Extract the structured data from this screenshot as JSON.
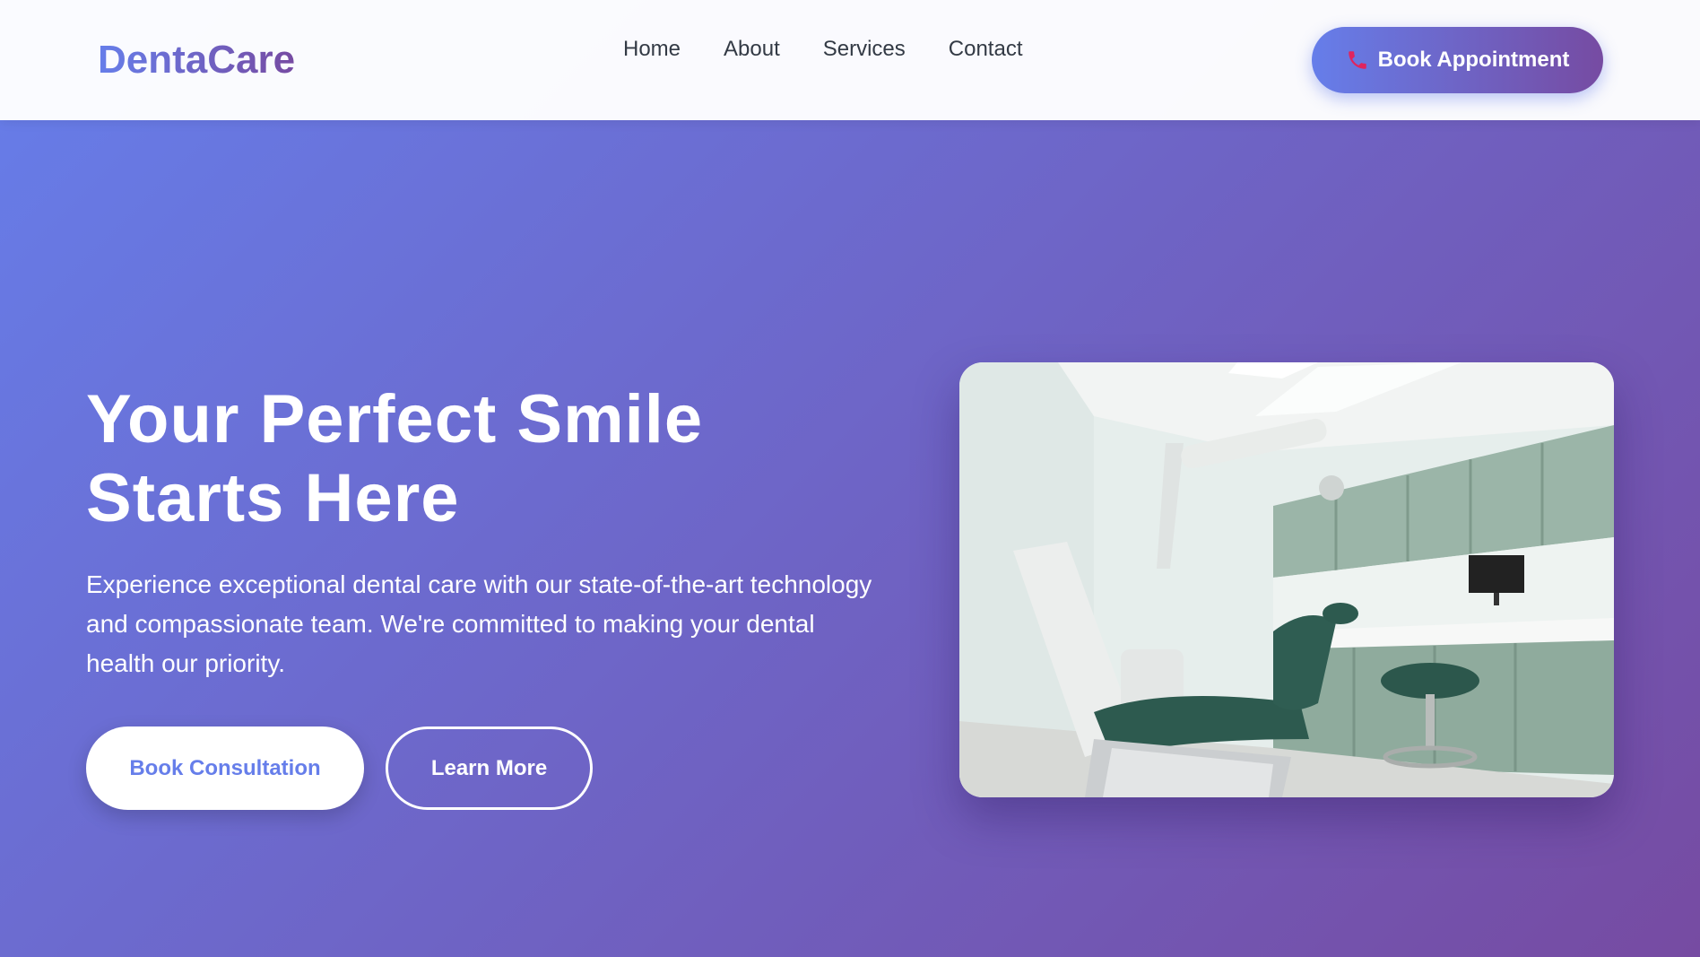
{
  "header": {
    "logo": "DentaCare",
    "nav": [
      "Home",
      "About",
      "Services",
      "Contact"
    ],
    "cta_label": "Book Appointment",
    "cta_icon": "phone-icon"
  },
  "hero": {
    "title_line1": "Your Perfect Smile",
    "title_line2": "Starts Here",
    "description": "Experience exceptional dental care with our state-of-the-art technology and compassionate team. We're committed to making your dental health our priority.",
    "primary_button": "Book Consultation",
    "secondary_button": "Learn More"
  },
  "colors": {
    "gradient_start": "#667eea",
    "gradient_end": "#764ba2",
    "phone_icon": "#e0245e"
  }
}
